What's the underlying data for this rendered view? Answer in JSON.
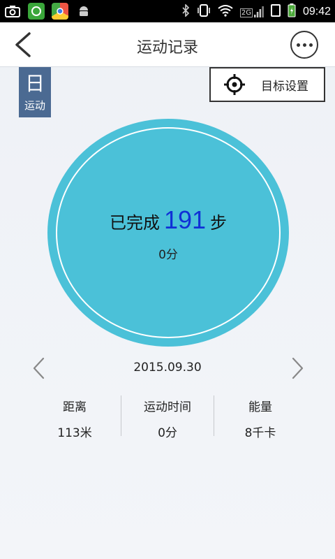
{
  "status_bar": {
    "signal_label": "2G",
    "time": "09:42",
    "icons": [
      "camera-icon",
      "phone-app-icon",
      "chrome-icon",
      "android-icon",
      "bluetooth-icon",
      "vibrate-icon",
      "wifi-icon",
      "signal-icon",
      "battery-icon"
    ]
  },
  "nav": {
    "title": "运动记录",
    "back_icon": "chevron-left-icon",
    "more_icon": "more-dots-icon"
  },
  "day_tab": {
    "char": "日",
    "label": "运动"
  },
  "goal_button": {
    "label": "目标设置",
    "icon": "crosshair-icon"
  },
  "progress": {
    "prefix": "已完成",
    "steps": "191",
    "suffix": "步",
    "minutes": "0分"
  },
  "date": {
    "value": "2015.09.30"
  },
  "stats": [
    {
      "label": "距离",
      "value": "113米"
    },
    {
      "label": "运动时间",
      "value": "0分"
    },
    {
      "label": "能量",
      "value": "8千卡"
    }
  ],
  "colors": {
    "circle": "#4bc1d8",
    "tab": "#4b6a92",
    "steps_number": "#1030d6"
  }
}
